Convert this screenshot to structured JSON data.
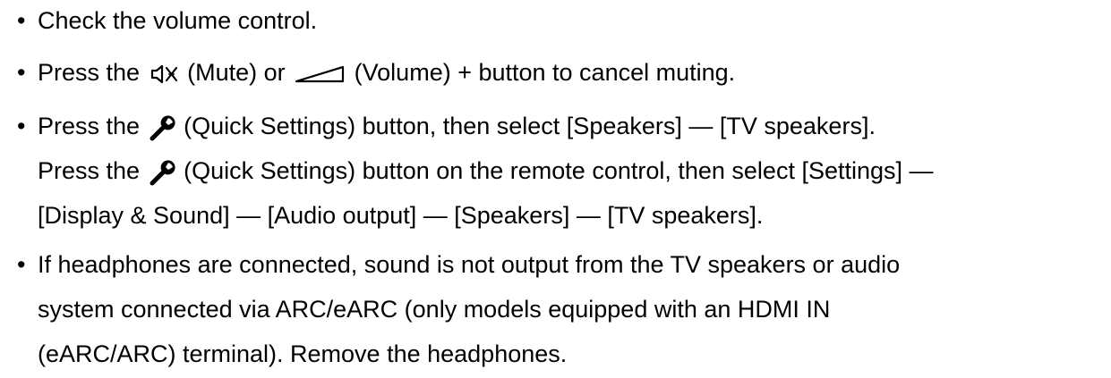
{
  "bullets": [
    {
      "symbol": "•",
      "text": "Check the volume control."
    },
    {
      "symbol": "•",
      "part1": "Press the",
      "mute_icon": "mute-icon",
      "part2": "(Mute) or",
      "volume_icon": "volume-icon",
      "part3": "(Volume) + button to cancel muting."
    },
    {
      "symbol": "•",
      "line1_part1": "Press the",
      "wrench_icon": "wrench-icon",
      "line1_part2": "(Quick Settings) button, then select [Speakers] — [TV speakers].",
      "line2_part1": "Press the",
      "line2_part2": "(Quick Settings) button on the remote control, then select [Settings] —",
      "line3": "[Display & Sound] — [Audio output] — [Speakers] — [TV speakers]."
    },
    {
      "symbol": "•",
      "line1": "If headphones are connected, sound is not output from the TV speakers or audio",
      "line2": "system connected via ARC/eARC (only models equipped with an HDMI IN",
      "line3": "(eARC/ARC) terminal). Remove the headphones."
    }
  ],
  "colors": {
    "text": "#000000",
    "background": "#ffffff"
  }
}
